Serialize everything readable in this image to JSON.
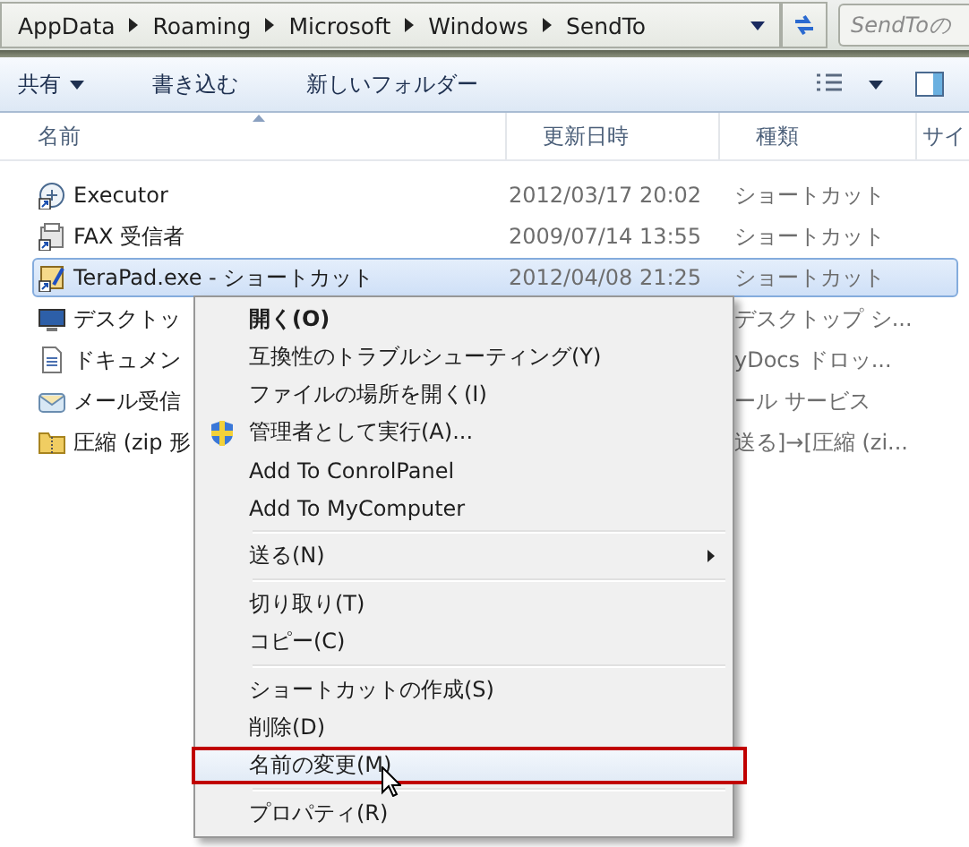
{
  "address_bar": {
    "crumbs": [
      "AppData",
      "Roaming",
      "Microsoft",
      "Windows",
      "SendTo"
    ],
    "search_placeholder": "SendToの"
  },
  "toolbar": {
    "items": [
      {
        "label": "共有",
        "dropdown": true
      },
      {
        "label": "書き込む",
        "dropdown": false
      },
      {
        "label": "新しいフォルダー",
        "dropdown": false
      }
    ]
  },
  "columns": [
    "名前",
    "更新日時",
    "種類",
    "サイ"
  ],
  "files": [
    {
      "name": "Executor",
      "date": "2012/03/17 20:02",
      "type": "ショートカット",
      "selected": false
    },
    {
      "name": "FAX 受信者",
      "date": "2009/07/14 13:55",
      "type": "ショートカット",
      "selected": false
    },
    {
      "name": "TeraPad.exe - ショートカット",
      "date": "2012/04/08 21:25",
      "type": "ショートカット",
      "selected": true
    },
    {
      "name": "デスクトッ",
      "type": "デスクトップ シ...",
      "selected": false
    },
    {
      "name": "ドキュメン",
      "type": "yDocs ドロッ...",
      "selected": false
    },
    {
      "name": "メール受信",
      "type": "ール サービス",
      "selected": false
    },
    {
      "name": "圧縮 (zip 形",
      "type": "送る]→[圧縮 (zi...",
      "selected": false
    }
  ],
  "context_menu": {
    "groups": [
      [
        {
          "label": "開く(O)",
          "kind": "command",
          "default": true,
          "hovered": false
        },
        {
          "label": "互換性のトラブルシューティング(Y)",
          "kind": "command",
          "default": false,
          "hovered": false
        },
        {
          "label": "ファイルの場所を開く(I)",
          "kind": "command",
          "default": false,
          "hovered": false
        },
        {
          "label": "管理者として実行(A)...",
          "kind": "elevated",
          "default": false,
          "hovered": false
        },
        {
          "label": "Add To ConrolPanel",
          "kind": "command",
          "default": false,
          "hovered": false
        },
        {
          "label": "Add To MyComputer",
          "kind": "command",
          "default": false,
          "hovered": false
        }
      ],
      [
        {
          "label": "送る(N)",
          "kind": "submenu",
          "default": false,
          "hovered": false
        }
      ],
      [
        {
          "label": "切り取り(T)",
          "kind": "command",
          "default": false,
          "hovered": false
        },
        {
          "label": "コピー(C)",
          "kind": "command",
          "default": false,
          "hovered": false
        }
      ],
      [
        {
          "label": "ショートカットの作成(S)",
          "kind": "command",
          "default": false,
          "hovered": false
        },
        {
          "label": "削除(D)",
          "kind": "command",
          "default": false,
          "hovered": false
        },
        {
          "label": "名前の変更(M)",
          "kind": "command",
          "default": false,
          "hovered": true
        }
      ],
      [
        {
          "label": "プロパティ(R)",
          "kind": "command",
          "default": false,
          "hovered": false
        }
      ]
    ]
  }
}
